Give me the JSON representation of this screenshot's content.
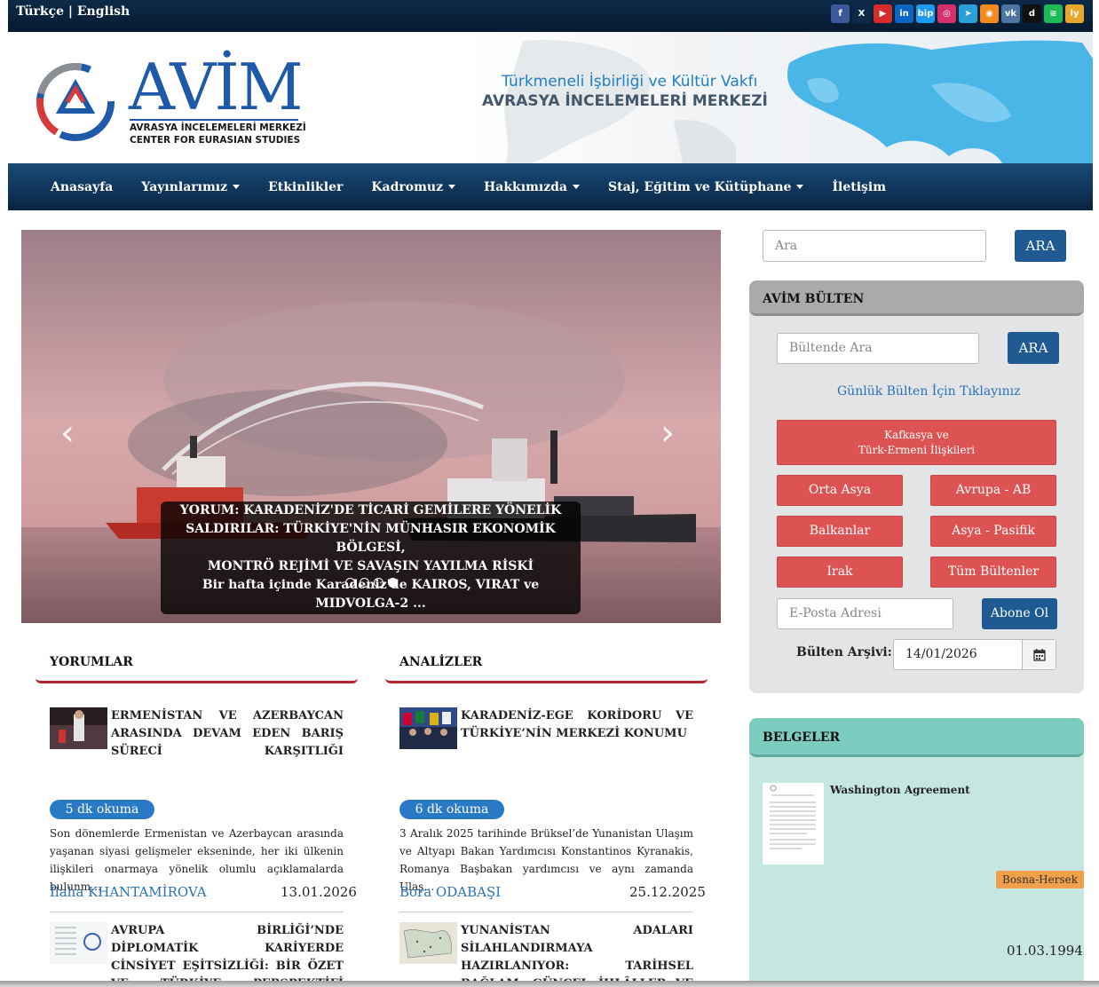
{
  "topbar": {
    "lang_tr": "Türkçe",
    "lang_sep": "|",
    "lang_en": "English",
    "social": [
      {
        "icon": "facebook-icon",
        "glyph": "f",
        "color": "#3b5998"
      },
      {
        "icon": "x-icon",
        "glyph": "X",
        "color": "#0c2a48"
      },
      {
        "icon": "youtube-icon",
        "glyph": "▶",
        "color": "#d42b2b"
      },
      {
        "icon": "linkedin-icon",
        "glyph": "in",
        "color": "#0a66c2"
      },
      {
        "icon": "bip-icon",
        "glyph": "bip",
        "color": "#1d9bf0"
      },
      {
        "icon": "instagram-icon",
        "glyph": "◎",
        "color": "#d6306b"
      },
      {
        "icon": "telegram-icon",
        "glyph": "➤",
        "color": "#2a9fd8"
      },
      {
        "icon": "rss-icon",
        "glyph": "◉",
        "color": "#f28a1e"
      },
      {
        "icon": "vk-icon",
        "glyph": "vk",
        "color": "#4c75a3"
      },
      {
        "icon": "dailymotion-icon",
        "glyph": "d",
        "color": "#111111"
      },
      {
        "icon": "spotify-icon",
        "glyph": "≋",
        "color": "#1db954"
      },
      {
        "icon": "nsosyal-icon",
        "glyph": "ly",
        "color": "#e8a72a"
      }
    ]
  },
  "header": {
    "logo_word": "AVİM",
    "logo_sub1": "AVRASYA İNCELEMELERİ MERKEZİ",
    "logo_sub2": "CENTER FOR EURASIAN STUDIES",
    "tagline1": "Türkmeneli İşbirliği ve Kültür Vakfı",
    "tagline2": "AVRASYA İNCELEMELERİ MERKEZİ"
  },
  "nav": {
    "items": [
      {
        "label": "Anasayfa",
        "dropdown": false
      },
      {
        "label": "Yayınlarımız",
        "dropdown": true
      },
      {
        "label": "Etkinlikler",
        "dropdown": false
      },
      {
        "label": "Kadromuz",
        "dropdown": true
      },
      {
        "label": "Hakkımızda",
        "dropdown": true
      },
      {
        "label": "Staj, Eğitim ve Kütüphane",
        "dropdown": true
      },
      {
        "label": "İletişim",
        "dropdown": false
      }
    ]
  },
  "slider": {
    "prev": "‹",
    "next": "›",
    "title_line1": "YORUM: KARADENİZ'DE TİCARİ GEMİLERE YÖNELİK",
    "title_line2": "SALDIRILAR: TÜRKİYE'NİN MÜNHASIR EKONOMİK BÖLGESİ,",
    "title_line3": "MONTRÖ REJİMİ VE SAVAŞIN YAYILMA RİSKİ",
    "description": "Bir hafta içinde Karadeniz'de KAIROS, VIRAT ve MIDVOLGA-2 ...",
    "slide_count": 4,
    "active_slide": 4
  },
  "yorumlar": {
    "title": "YORUMLAR",
    "article1": {
      "title": "ERMENİSTAN VE AZERBAYCAN ARASINDA DEVAM EDEN BARIŞ SÜRECİ KARŞITLIĞI",
      "read_time": "5 dk okuma",
      "excerpt": "Son dönemlerde Ermenistan ve Azerbaycan arasında yaşanan siyasi gelişmeler ekseninde, her iki ülkenin ilişkileri onarmaya yönelik olumlu açıklamalarda bulunm…",
      "author": "İlaha KHANTAMİROVA",
      "date": "13.01.2026"
    },
    "article2": {
      "title": "AVRUPA BİRLİĞİ’NDE DİPLOMATİK KARİYERDE CİNSİYET EŞİTSİZLİĞİ: BİR ÖZET VE TÜRKİYE PERSPEKTİFİ"
    }
  },
  "analizler": {
    "title": "ANALİZLER",
    "article1": {
      "title": "KARADENİZ-EGE KORİDORU VE TÜRKİYE’NİN MERKEZİ KONUMU",
      "read_time": "6 dk okuma",
      "excerpt": "3 Aralık 2025 tarihinde Brüksel’de Yunanistan Ulaşım ve Altyapı Bakan Yardımcısı Konstantinos Kyranakis, Romanya Başbakan yardımcısı ve aynı zamanda Ulaş…",
      "author": "Bora ODABAŞI",
      "date": "25.12.2025"
    },
    "article2": {
      "title": "YUNANİSTAN ADALARI SİLAHLANDIRMAYA HAZIRLANIYOR: TARİHSEL BAĞLAM, GÜNCEL İHLÂLLER VE YOL AÇABİLECEĞİ"
    }
  },
  "sidebar": {
    "search_placeholder": "Ara",
    "search_button": "ARA",
    "bulten": {
      "title": "AVİM BÜLTEN",
      "search_placeholder": "Bültende Ara",
      "search_button": "ARA",
      "daily_link": "Günlük Bülten İçin Tıklayınız",
      "topic_main_line1": "Kafkasya ve",
      "topic_main_line2": "Türk-Ermeni İlişkileri",
      "topics": [
        "Orta Asya",
        "Avrupa - AB",
        "Balkanlar",
        "Asya - Pasifik",
        "Irak",
        "Tüm Bültenler"
      ],
      "email_placeholder": "E-Posta Adresi",
      "subscribe_button": "Abone Ol",
      "archive_label": "Bülten Arşivi:",
      "archive_date": "14/01/2026"
    },
    "belgeler": {
      "title": "BELGELER",
      "doc_title": "Washington Agreement",
      "doc_tag": "Bosna-Hersek",
      "doc_date": "01.03.1994"
    }
  }
}
